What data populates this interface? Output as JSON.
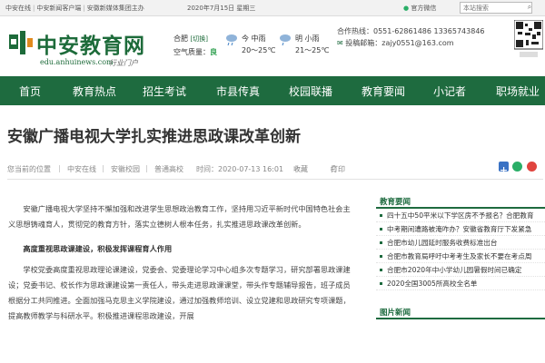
{
  "topbar": {
    "links": [
      "中安在线",
      "中安新闻客户端",
      "安徽新媒体集团主办"
    ],
    "date": "2020年7月15日 星期三",
    "account_label": "官方微信",
    "search_placeholder": "本站搜索",
    "search_button": "⌕"
  },
  "logo": {
    "name": "中安教育网",
    "domain": "edu.anhuinews.com",
    "slogan": "行业门户"
  },
  "weather": {
    "city": "合肥",
    "city_tag": "[切换]",
    "air_label": "空气质量：",
    "air_value": "良",
    "days": [
      {
        "label": "今 中雨",
        "temp": "20～25℃"
      },
      {
        "label": "明 小雨",
        "temp": "21～25℃"
      }
    ]
  },
  "contact": {
    "phone_label": "合作热线：0551-62861486 13365743846",
    "email_label": "投稿邮箱：zajy0551@163.com"
  },
  "nav": [
    "首页",
    "教育热点",
    "招生考试",
    "市县传真",
    "校园联播",
    "教育要闻",
    "小记者",
    "职场就业"
  ],
  "article": {
    "title": "安徽广播电视大学扎实推进思政课改革创新",
    "breadcrumb_label": "您当前的位置",
    "breadcrumb": [
      "中安在线",
      "安徽校园",
      "普通高校"
    ],
    "time": "时间：2020-07-13 16:01",
    "favorite": "收藏",
    "print": "打印",
    "paragraphs": [
      "安徽广播电视大学坚持不懈加强和改进学生思想政治教育工作，坚持用习近平新时代中国特色社会主义思想铸魂育人，贯彻党的教育方针，落实立德树人根本任务，扎实推进思政课改革创新。",
      "高度重视思政课建设，积极发挥课程育人作用",
      "学校党委高度重视思政理论课建设，党委会、党委理论学习中心组多次专题学习，研究部署思政课建设；党委书记、校长作为思政课建设第一责任人，带头走进思政课课堂，带头作专题辅导报告，班子成员根据分工共同推进。全面加强马克思主义学院建设，通过加强教师培训、设立党建和思政研究专项课题，提高教师教学与科研水平。积极推进课程思政建设，开展"
    ]
  },
  "sidebar": {
    "news_title": "教育要闻",
    "news": [
      "四十五中50平米以下学区房不予报名？合肥教育",
      "中考期间遭路被淹咋办？安徽省教育厅下发紧急",
      "合肥市幼儿园延时服务收费标准出台",
      "合肥市教育局呼吁中考考生及家长不要在考点周",
      "合肥市2020年中小学幼儿园暑假时间已确定",
      "2020全国3005所高校全名单"
    ],
    "pics_title": "图片新闻"
  },
  "colors": {
    "brand": "#1e6b3f",
    "accent": "#c8161d"
  }
}
